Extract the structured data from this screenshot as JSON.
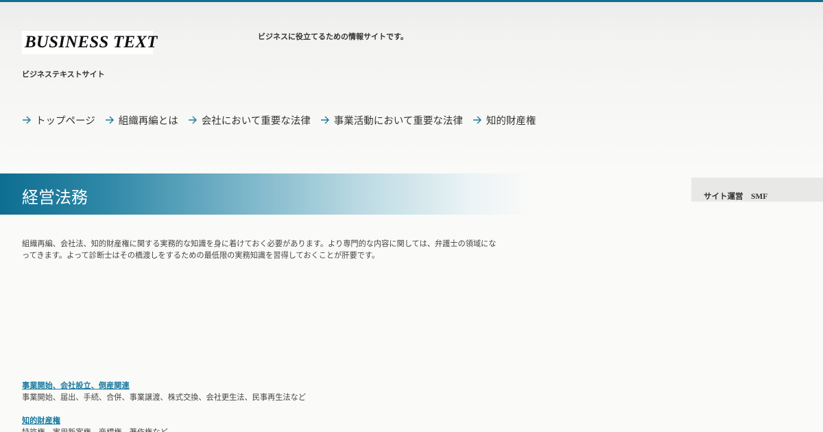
{
  "header": {
    "logo_text": "BUSINESS TEXT",
    "site_name": "ビジネステキストサイト",
    "tagline": "ビジネスに役立てるための情報サイトです。"
  },
  "nav": {
    "items": [
      {
        "label": "トップページ",
        "icon": "arrow-right-icon"
      },
      {
        "label": "組織再編とは",
        "icon": "arrow-right-icon"
      },
      {
        "label": "会社において重要な法律",
        "icon": "arrow-right-icon"
      },
      {
        "label": "事業活動において重要な法律",
        "icon": "arrow-right-icon"
      },
      {
        "label": "知的財産権",
        "icon": "arrow-right-icon"
      }
    ]
  },
  "hero": {
    "title": "経営法務"
  },
  "sidebar": {
    "operator_text": "サイト運営　SMF"
  },
  "main": {
    "intro": "組織再編、会社法、知的財産権に関する実務的な知識を身に着けておく必要があります。より専門的な内容に関しては、弁護士の領域になってきます。よって診断士はその橋渡しをするための最低限の実務知識を習得しておくことが肝要です。",
    "sections": [
      {
        "title": "事業開始、会社設立、倒産関連",
        "desc": "事業開始、届出、手続、合併、事業譲渡、株式交換、会社更生法、民事再生法など"
      },
      {
        "title": "知的財産権",
        "desc": "特許権、実用新案権、商標権、著作権など"
      }
    ]
  },
  "colors": {
    "accent": "#0f6f8f",
    "link": "#1a7aa0",
    "hero_start": "#0e6e92"
  }
}
